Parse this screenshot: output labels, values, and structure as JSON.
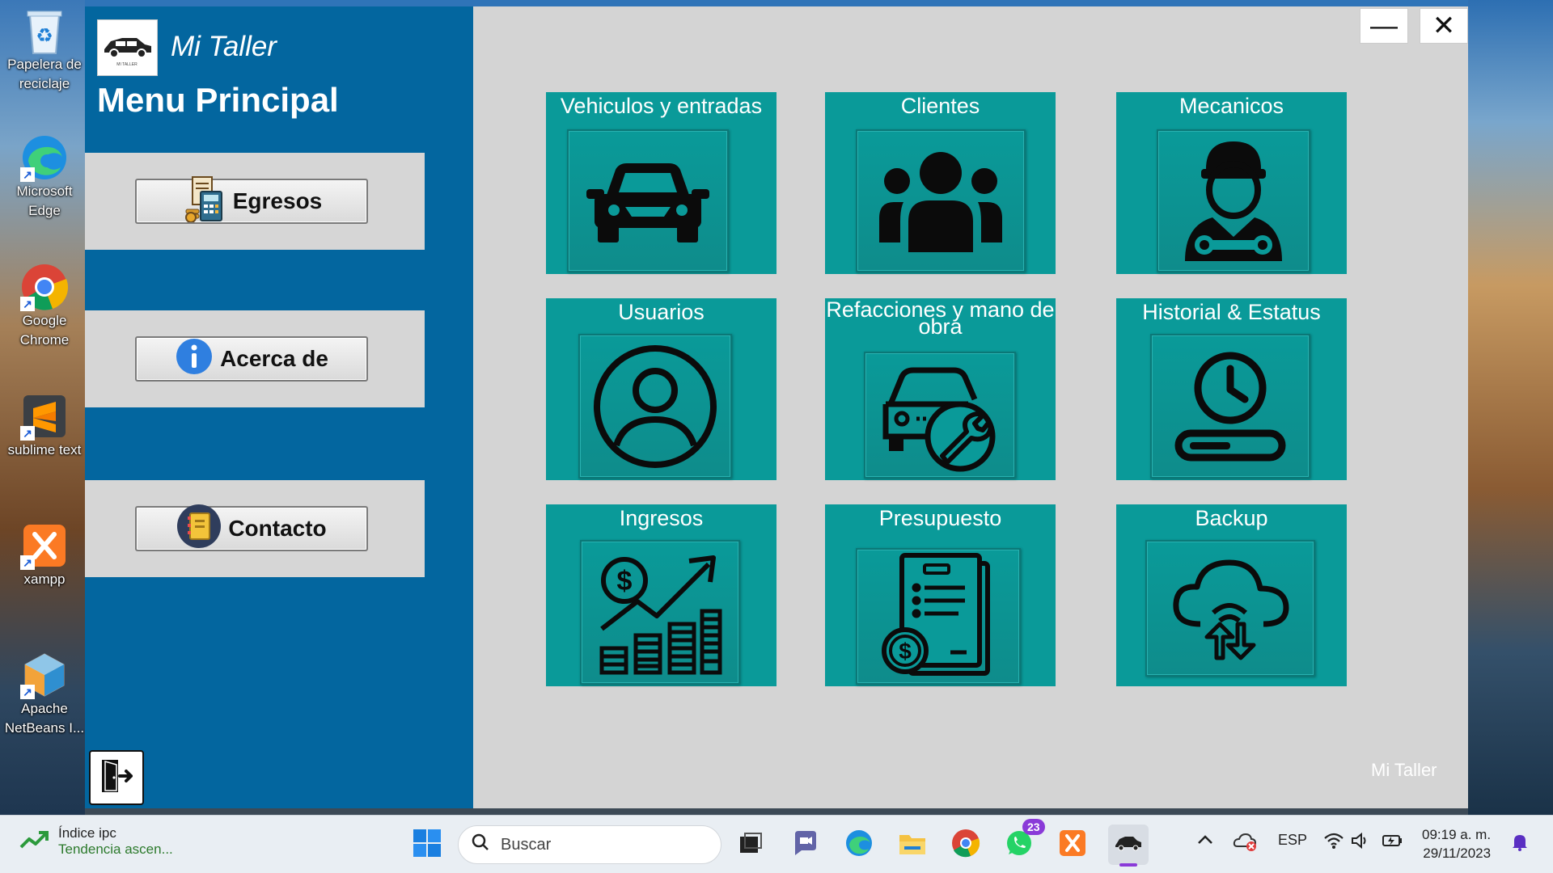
{
  "desktop": {
    "icons": [
      {
        "label": "Papelera de reciclaje",
        "icon": "recycle-bin-icon"
      },
      {
        "label": "Microsoft Edge",
        "icon": "edge-icon"
      },
      {
        "label": "Google Chrome",
        "icon": "chrome-icon"
      },
      {
        "label": "sublime text",
        "icon": "sublime-icon"
      },
      {
        "label": "xampp",
        "icon": "xampp-icon"
      },
      {
        "label": "Apache NetBeans I...",
        "icon": "netbeans-icon"
      }
    ]
  },
  "app": {
    "name": "Mi Taller",
    "menu_title": "Menu Principal",
    "footer": "Mi Taller",
    "logo_text": "MI TALLER",
    "side_buttons": [
      {
        "label": "Egresos",
        "icon": "calculator-money-icon"
      },
      {
        "label": "Acerca de",
        "icon": "info-icon"
      },
      {
        "label": "Contacto",
        "icon": "address-book-icon"
      }
    ],
    "window_controls": {
      "minimize": "—",
      "close": "✕"
    },
    "tiles": [
      {
        "label": "Vehiculos y entradas",
        "icon": "car-icon"
      },
      {
        "label": "Clientes",
        "icon": "group-icon"
      },
      {
        "label": "Mecanicos",
        "icon": "mechanic-icon"
      },
      {
        "label": "Usuarios",
        "icon": "user-circle-icon"
      },
      {
        "label": "Refacciones y mano de obra",
        "icon": "car-wrench-icon"
      },
      {
        "label": "Historial & Estatus",
        "icon": "clock-status-icon"
      },
      {
        "label": "Ingresos",
        "icon": "income-chart-icon"
      },
      {
        "label": "Presupuesto",
        "icon": "budget-document-icon"
      },
      {
        "label": "Backup",
        "icon": "cloud-sync-icon"
      }
    ],
    "colors": {
      "sidebar": "#03669f",
      "tile": "#0a9a99",
      "main_bg": "#d4d4d4"
    }
  },
  "taskbar": {
    "widget_title": "Índice ipc",
    "widget_subtitle": "Tendencia ascen...",
    "search_placeholder": "Buscar",
    "whatsapp_badge": "23",
    "language": "ESP",
    "time": "09:19 a. m.",
    "date": "29/11/2023"
  }
}
